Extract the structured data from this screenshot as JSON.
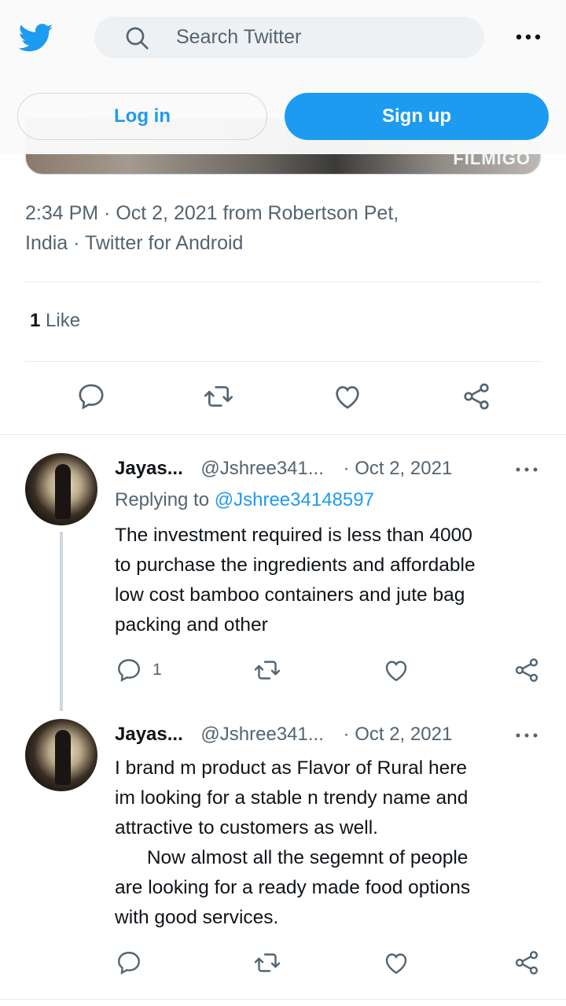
{
  "header": {
    "search_placeholder": "Search Twitter",
    "login_label": "Log in",
    "signup_label": "Sign up"
  },
  "media": {
    "watermark": "FILMIGO"
  },
  "tweet": {
    "meta_line1": "2:34 PM · Oct 2, 2021 from Robertson Pet,",
    "meta_line2": "India · Twitter for Android",
    "likes_count": "1",
    "likes_label": "Like"
  },
  "replies": [
    {
      "name": "Jayas...",
      "handle": "@Jshree341...",
      "date": "· Oct 2, 2021",
      "replying_prefix": "Replying to",
      "replying_to": "@Jshree34148597",
      "text": "The investment required is less than 4000\nto purchase the ingredients and affordable\nlow cost bamboo containers and jute bag\npacking and other",
      "reply_count": "1"
    },
    {
      "name": "Jayas...",
      "handle": "@Jshree341...",
      "date": "· Oct 2, 2021",
      "text": "I brand m product as Flavor of Rural here\nim looking for a stable n trendy name and\nattractive to customers as well.\n      Now almost all the segemnt of people\nare looking for a ready made food options\nwith good services.",
      "reply_count": ""
    }
  ],
  "colors": {
    "accent": "#1d9bf0",
    "secondary_text": "#536471",
    "primary_text": "#0f1419",
    "divider": "#e6ecf0"
  },
  "icons": [
    "twitter-logo-icon",
    "search-icon",
    "more-icon",
    "reply-icon",
    "retweet-icon",
    "like-icon",
    "share-icon"
  ]
}
